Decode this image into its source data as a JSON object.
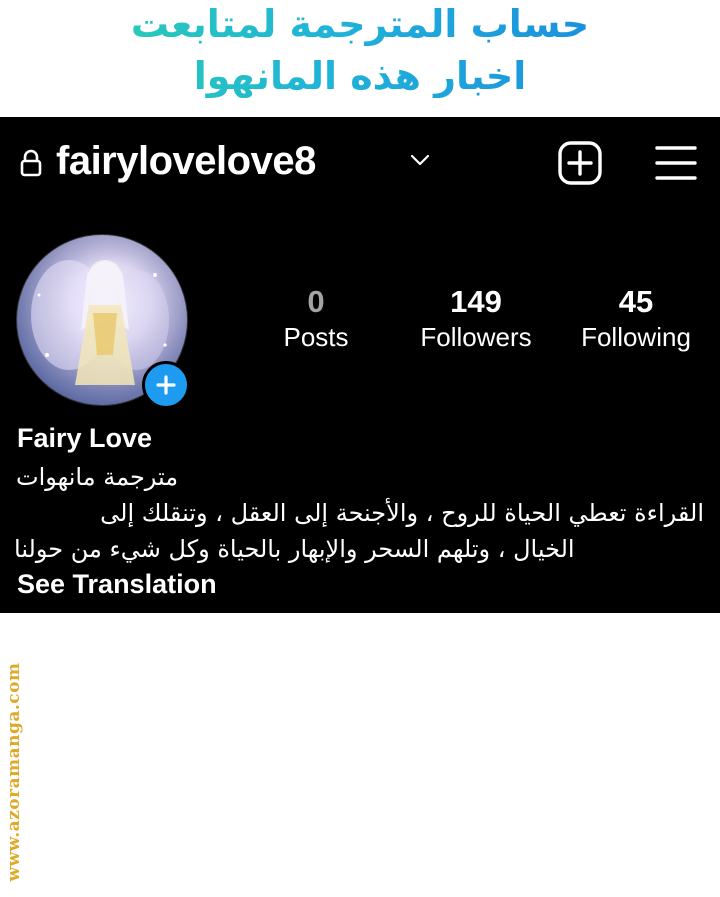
{
  "banner": {
    "line1": "حساب المترجمة لمتابعت",
    "line2": "اخبار هذه المانهوا"
  },
  "header": {
    "username": "fairylovelove8",
    "icons": [
      "lock-icon",
      "chevron-down-icon",
      "add-post-icon",
      "menu-icon"
    ]
  },
  "stats": {
    "posts": {
      "value": "0",
      "label": "Posts"
    },
    "followers": {
      "value": "149",
      "label": "Followers"
    },
    "following": {
      "value": "45",
      "label": "Following"
    }
  },
  "profile": {
    "display_name": "Fairy Love",
    "role": "مترجمة مانهوات",
    "bio_line1": "القراءة تعطي الحياة للروح ، والأجنحة إلى العقل ، وتنقلك إلى",
    "bio_line2": "الخيال ، وتلهم السحر والإبهار بالحياة وكل شيء من حولنا",
    "see_translation": "See Translation"
  },
  "watermark": "www.azoramanga.com",
  "colors": {
    "profile_bg": "#000000",
    "add_story_blue": "#1c9bf0",
    "watermark_gold": "#e0a928",
    "banner_gradient": [
      "#2fd6a6",
      "#1fb4d8",
      "#1b7fe0"
    ]
  }
}
